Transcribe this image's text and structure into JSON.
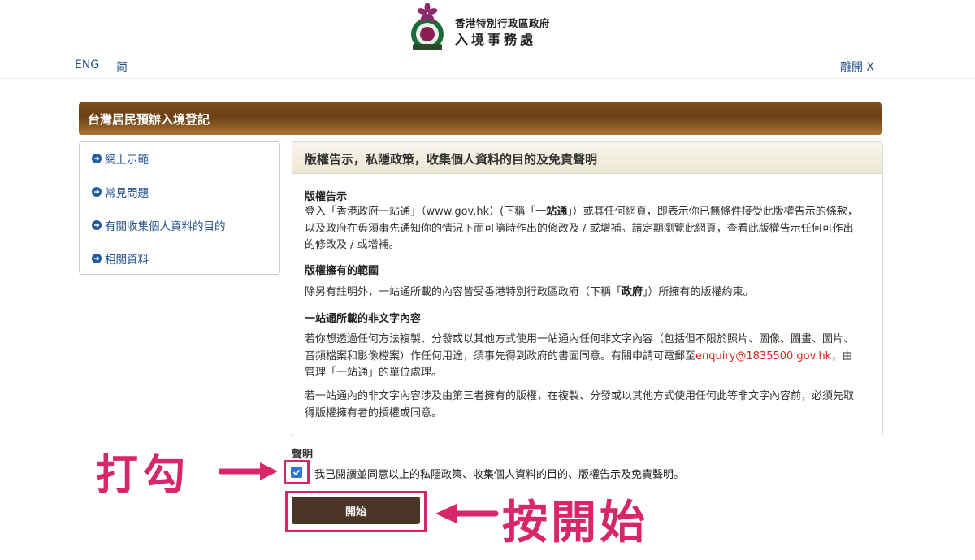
{
  "header": {
    "org_line1": "香港特別行政區政府",
    "org_line2": "入境事務處"
  },
  "lang_links": [
    "ENG",
    "简"
  ],
  "exit_label": "離開 X",
  "page_title": "台灣居民預辦入境登記",
  "sidebar": {
    "items": [
      {
        "label": "網上示範"
      },
      {
        "label": "常見問題"
      },
      {
        "label": "有關收集個人資料的目的"
      },
      {
        "label": "相關資料"
      }
    ]
  },
  "panel": {
    "title": "版權告示，私隱政策，收集個人資料的目的及免責聲明",
    "section1_heading": "版權告示",
    "section1_p1": "登入「香港政府一站通」（www.gov.hk）(下稱「",
    "section1_p1_bold": "一站通",
    "section1_p1_rest": "」）或其任何網頁，即表示你已無條件接受此版權告示的條款，以及政府在毋須事先通知你的情況下而可隨時作出的修改及 / 或增補。請定期瀏覽此網頁，查看此版權告示任何可作出的修改及 / 或增補。",
    "section2_heading": "版權擁有的範圍",
    "section2_p1": "除另有註明外，一站通所載的內容皆受香港特別行政區政府（下稱「",
    "section2_p1_bold": "政府",
    "section2_p1_rest": "」）所擁有的版權約束。",
    "section3_heading": "一站通所載的非文字內容",
    "section3_p1": "若你想透過任何方法複製、分發或以其他方式使用一站通內任何非文字內容（包括但不限於照片、圖像、圖畫、圖片、音頻檔案和影像檔案）作任何用途，須事先得到政府的書面同意。有關申請可電郵至",
    "section3_email": "enquiry@1835500.gov.hk",
    "section3_p1_rest": "，由管理「一站通」的單位處理。",
    "section3_p2": "若一站通內的非文字內容涉及由第三者擁有的版權，在複製、分發或以其他方式使用任何此等非文字內容前，必須先取得版權擁有者的授權或同意。"
  },
  "declaration": {
    "label": "聲明",
    "checkbox_text": "我已閱讀並同意以上的私隱政策、收集個人資料的目的、版權告示及免責聲明。",
    "checked": true
  },
  "start_button": "開始",
  "annotations": {
    "left": "打勾",
    "right": "按開始",
    "color": "#d8266a"
  },
  "colors": {
    "link": "#1f4e8c",
    "title_bar": "#6a4015",
    "button": "#4a3528",
    "email": "#d0271e"
  },
  "icons": {
    "logo": "bauhinia-crest",
    "sidebar_bullet": "circle-arrow-right-icon",
    "checkbox": "checkmark-icon"
  }
}
